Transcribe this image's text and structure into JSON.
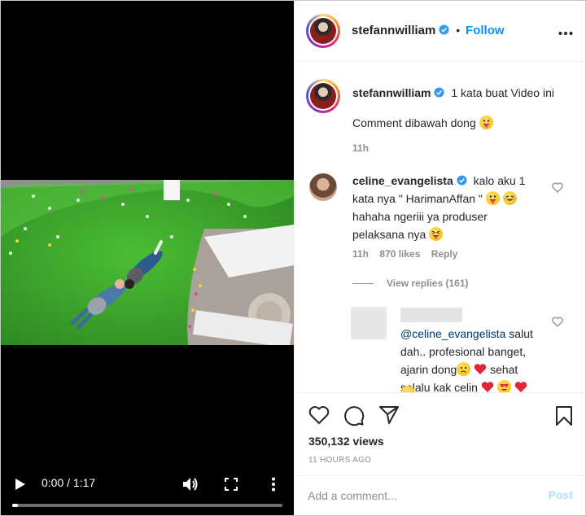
{
  "video": {
    "time_display": "0:00 / 1:17",
    "progress_fraction": 0.02
  },
  "header": {
    "username": "stefannwilliam",
    "separator": "•",
    "follow_label": "Follow"
  },
  "caption": {
    "username": "stefannwilliam",
    "text_line1": "1 kata buat Video ini",
    "text_line2": "Comment dibawah dong",
    "time": "11h"
  },
  "comments": [
    {
      "username": "celine_evangelista",
      "line1": "kalo aku 1",
      "line2": "kata nya \" HarimanAffan \"",
      "line3": "hahaha ngeriii ya produser",
      "line4": "pelaksana nya",
      "time": "11h",
      "likes": "870 likes",
      "reply_label": "Reply",
      "view_replies": "View replies (161)"
    }
  ],
  "reply": {
    "mention": "@celine_evangelista",
    "line1_rest": "salut",
    "line2": "dah.. profesional banget,",
    "line3": "ajarin dong",
    "line3_rest": "sehat",
    "line4": "selalu kak celin"
  },
  "stats": {
    "views": "350,132 views",
    "age": "11 HOURS AGO"
  },
  "add_comment": {
    "placeholder": "Add a comment...",
    "post_label": "Post"
  },
  "colors": {
    "link_blue": "#0095f6",
    "post_disabled": "#b2dffc",
    "grass": "#3aa32c"
  }
}
